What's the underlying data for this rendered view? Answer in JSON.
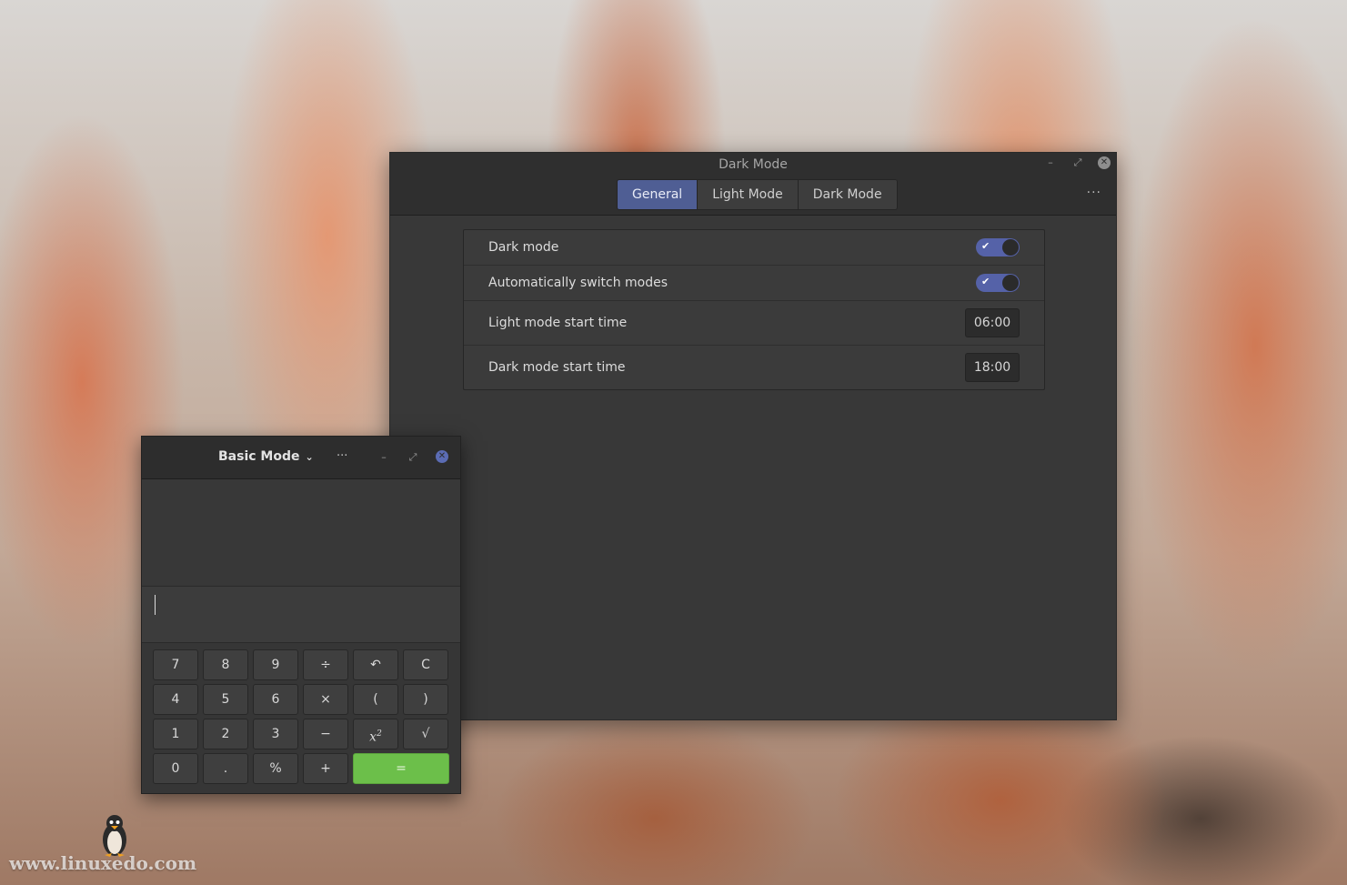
{
  "dark_mode_window": {
    "title": "Dark Mode",
    "controls": {
      "minimize": "–",
      "restore": "⤢",
      "close": "✕"
    },
    "tabs": [
      {
        "label": "General",
        "active": true
      },
      {
        "label": "Light Mode",
        "active": false
      },
      {
        "label": "Dark Mode",
        "active": false
      }
    ],
    "more_label": "···",
    "settings": {
      "dark_mode": {
        "label": "Dark mode",
        "enabled": true
      },
      "auto_switch": {
        "label": "Automatically switch modes",
        "enabled": true
      },
      "light_start": {
        "label": "Light mode start time",
        "value": "06:00"
      },
      "dark_start": {
        "label": "Dark mode start time",
        "value": "18:00"
      }
    },
    "toggle_check": "✔"
  },
  "calculator_window": {
    "title": "Basic Mode",
    "title_chevron": "⌄",
    "more_label": "···",
    "controls": {
      "minimize": "–",
      "restore": "⤢",
      "close": "✕"
    },
    "input_value": "",
    "keys": {
      "r0": [
        "7",
        "8",
        "9",
        "÷",
        "↶",
        "C"
      ],
      "r1": [
        "4",
        "5",
        "6",
        "×",
        "(",
        ")"
      ],
      "r2": [
        "1",
        "2",
        "3",
        "−",
        "x",
        "√"
      ],
      "r3": [
        "0",
        ".",
        "%",
        "+",
        "="
      ]
    },
    "square_superscript": "2"
  },
  "watermark": "www.linuxedo.com",
  "colors": {
    "accent": "#4f5e94",
    "toggle": "#5562a8",
    "equals": "#6cbf4a",
    "calc_close": "#5b6cb4"
  }
}
